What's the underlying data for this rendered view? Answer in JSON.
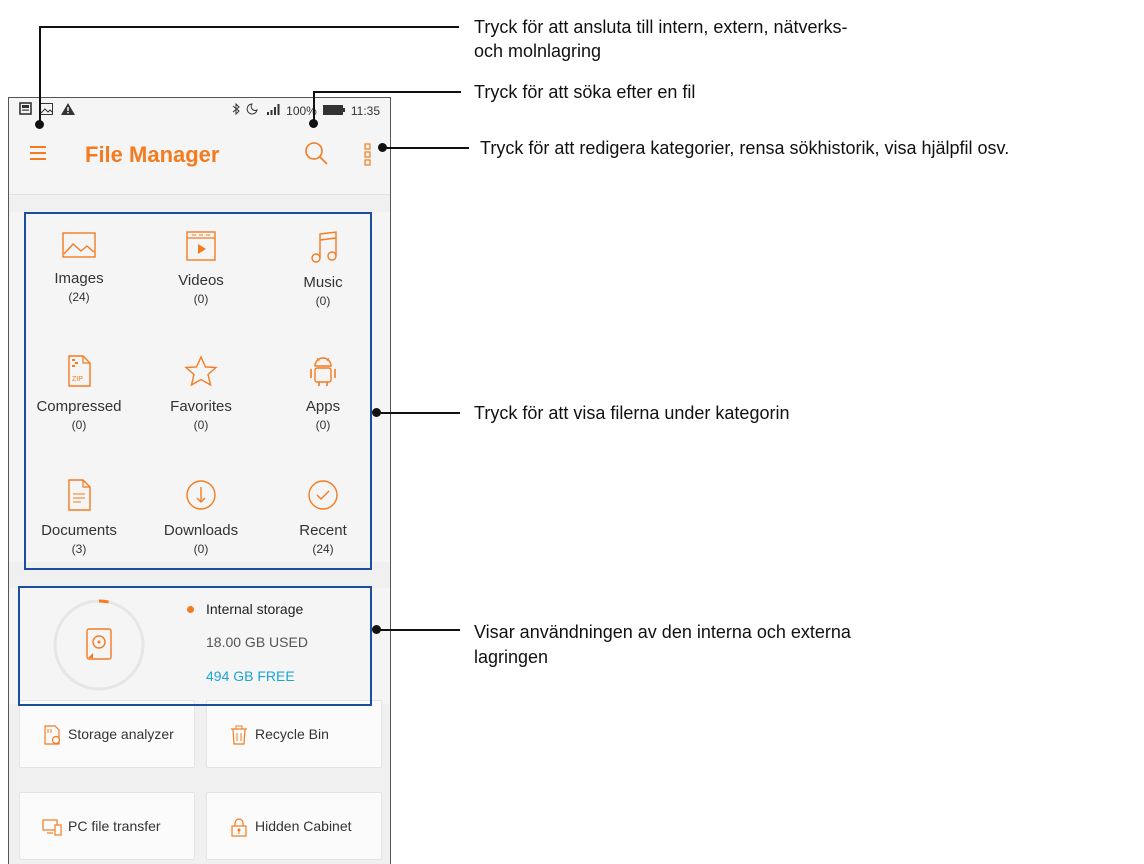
{
  "status_bar": {
    "battery": "100%",
    "time": "11:35"
  },
  "app": {
    "title": "File Manager"
  },
  "categories": [
    {
      "label": "Images",
      "count": "(24)",
      "icon": "image-icon"
    },
    {
      "label": "Videos",
      "count": "(0)",
      "icon": "video-icon"
    },
    {
      "label": "Music",
      "count": "(0)",
      "icon": "music-icon"
    },
    {
      "label": "Compressed",
      "count": "(0)",
      "icon": "zip-icon",
      "icon_text": "ZIP"
    },
    {
      "label": "Favorites",
      "count": "(0)",
      "icon": "star-icon"
    },
    {
      "label": "Apps",
      "count": "(0)",
      "icon": "android-icon"
    },
    {
      "label": "Documents",
      "count": "(3)",
      "icon": "document-icon"
    },
    {
      "label": "Downloads",
      "count": "(0)",
      "icon": "download-icon"
    },
    {
      "label": "Recent",
      "count": "(24)",
      "icon": "recent-icon"
    }
  ],
  "storage": {
    "name": "Internal storage",
    "used": "18.00 GB USED",
    "free": "494 GB FREE",
    "used_fraction": 0.035
  },
  "tools": [
    {
      "label": "Storage analyzer",
      "icon": "storage-analyzer-icon"
    },
    {
      "label": "Recycle Bin",
      "icon": "recycle-bin-icon"
    },
    {
      "label": "PC file transfer",
      "icon": "pc-transfer-icon"
    },
    {
      "label": "Hidden Cabinet",
      "icon": "lock-icon"
    }
  ],
  "annotations": {
    "menu": [
      "Tryck för att ansluta till intern, extern, nätverks-",
      "och molnlagring"
    ],
    "search": "Tryck för att söka efter en fil",
    "more": "Tryck för att redigera kategorier, rensa sökhistorik, visa hjälpfil osv.",
    "categories": "Tryck för att visa filerna under kategorin",
    "storage": [
      "Visar användningen av den interna och externa",
      "lagringen"
    ]
  },
  "colors": {
    "accent": "#f47b20",
    "free_text": "#1aa5d6",
    "callout_box": "#1a4f9c"
  }
}
